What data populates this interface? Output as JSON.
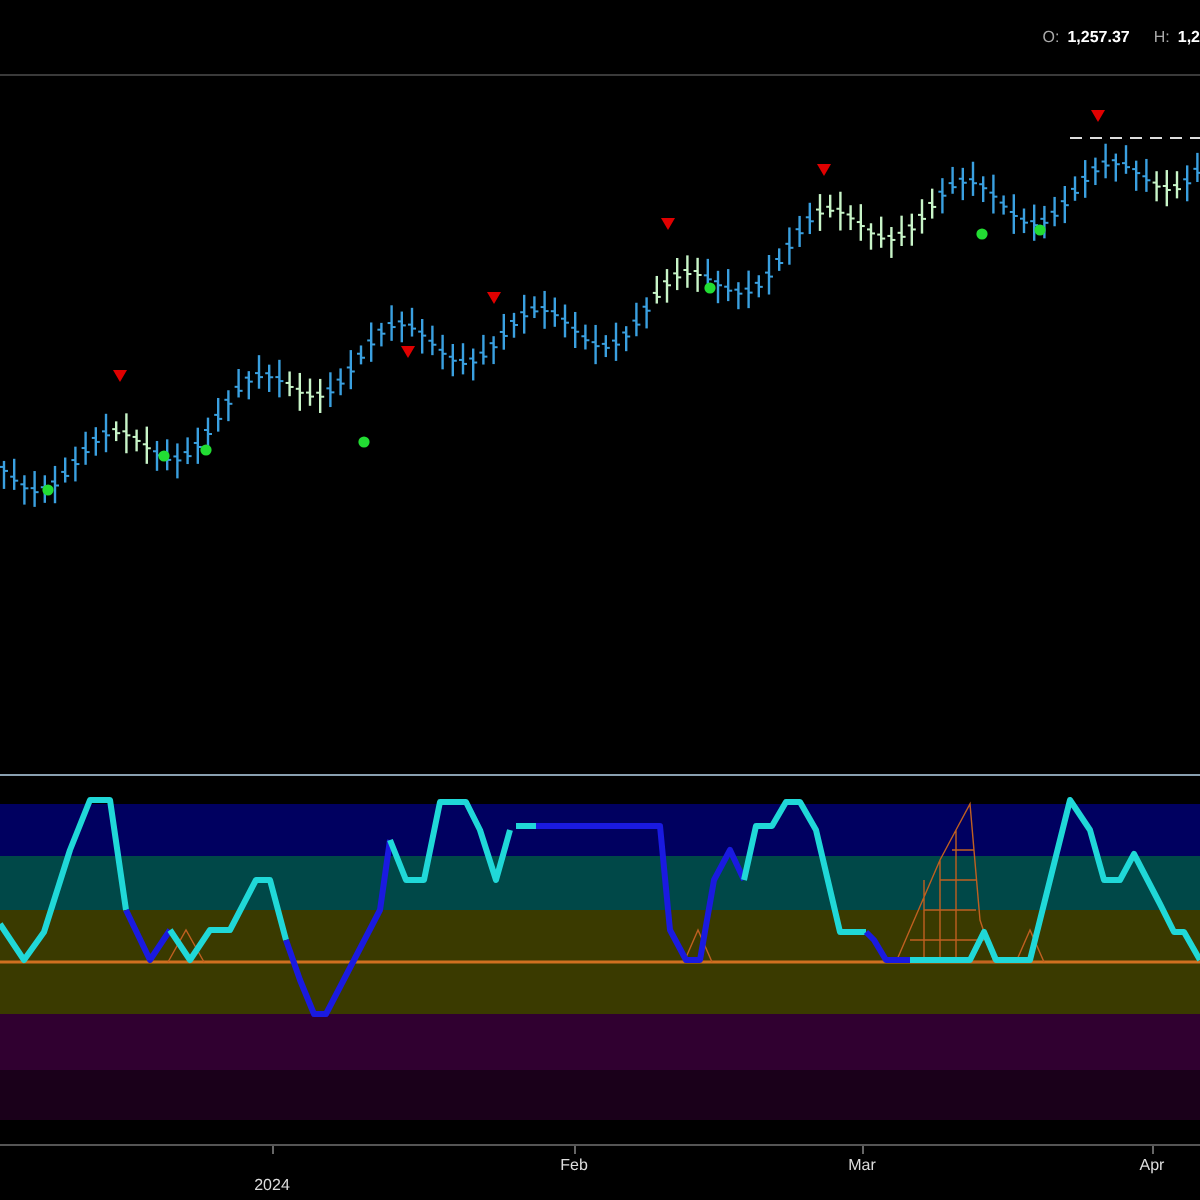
{
  "header": {
    "open_label": "O:",
    "open_value": "1,257.37",
    "high_label": "H:",
    "high_value": "1,2"
  },
  "time_axis": [
    {
      "label": "2024",
      "kind": "year"
    },
    {
      "label": "Feb",
      "kind": "month"
    },
    {
      "label": "Mar",
      "kind": "month"
    },
    {
      "label": "Apr",
      "kind": "month"
    }
  ]
}
